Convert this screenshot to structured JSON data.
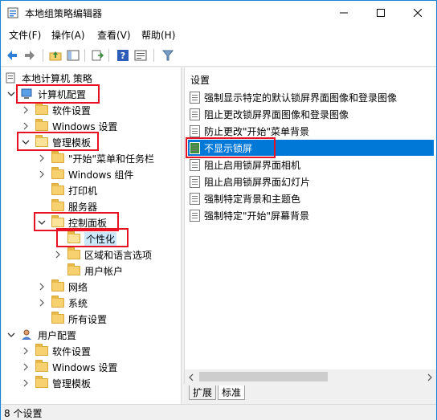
{
  "window": {
    "title": "本地组策略编辑器",
    "minimize": "—",
    "maximize": "☐",
    "close": "✕"
  },
  "menu": [
    "文件(F)",
    "操作(A)",
    "查看(V)",
    "帮助(H)"
  ],
  "toolbar": [
    "back-icon",
    "forward-icon",
    "up-folder-icon",
    "show-tree-icon",
    "export-icon",
    "help-icon",
    "properties-icon",
    "filter-icon"
  ],
  "tree": {
    "root": "本地计算机 策略",
    "computer_config": "计算机配置",
    "software_settings": "软件设置",
    "windows_settings": "Windows 设置",
    "admin_templates": "管理模板",
    "start_menu": "\"开始\"菜单和任务栏",
    "windows_components": "Windows 组件",
    "printers": "打印机",
    "server": "服务器",
    "control_panel": "控制面板",
    "personalization": "个性化",
    "regional": "区域和语言选项",
    "user_accounts": "用户帐户",
    "network": "网络",
    "system": "系统",
    "all_settings": "所有设置",
    "user_config": "用户配置",
    "user_software": "软件设置",
    "user_windows": "Windows 设置",
    "user_admin": "管理模板"
  },
  "settings": {
    "header": "设置",
    "items": [
      "强制显示特定的默认锁屏界面图像和登录图像",
      "阻止更改锁屏界面图像和登录图像",
      "防止更改\"开始\"菜单背景",
      "不显示锁屏",
      "阻止启用锁屏界面相机",
      "阻止启用锁屏界面幻灯片",
      "强制特定背景和主题色",
      "强制特定\"开始\"屏幕背景"
    ]
  },
  "tabs": [
    "扩展",
    "标准"
  ],
  "status": "8 个设置",
  "colors": {
    "accent": "#0078d7",
    "highlight": "#e81123"
  }
}
